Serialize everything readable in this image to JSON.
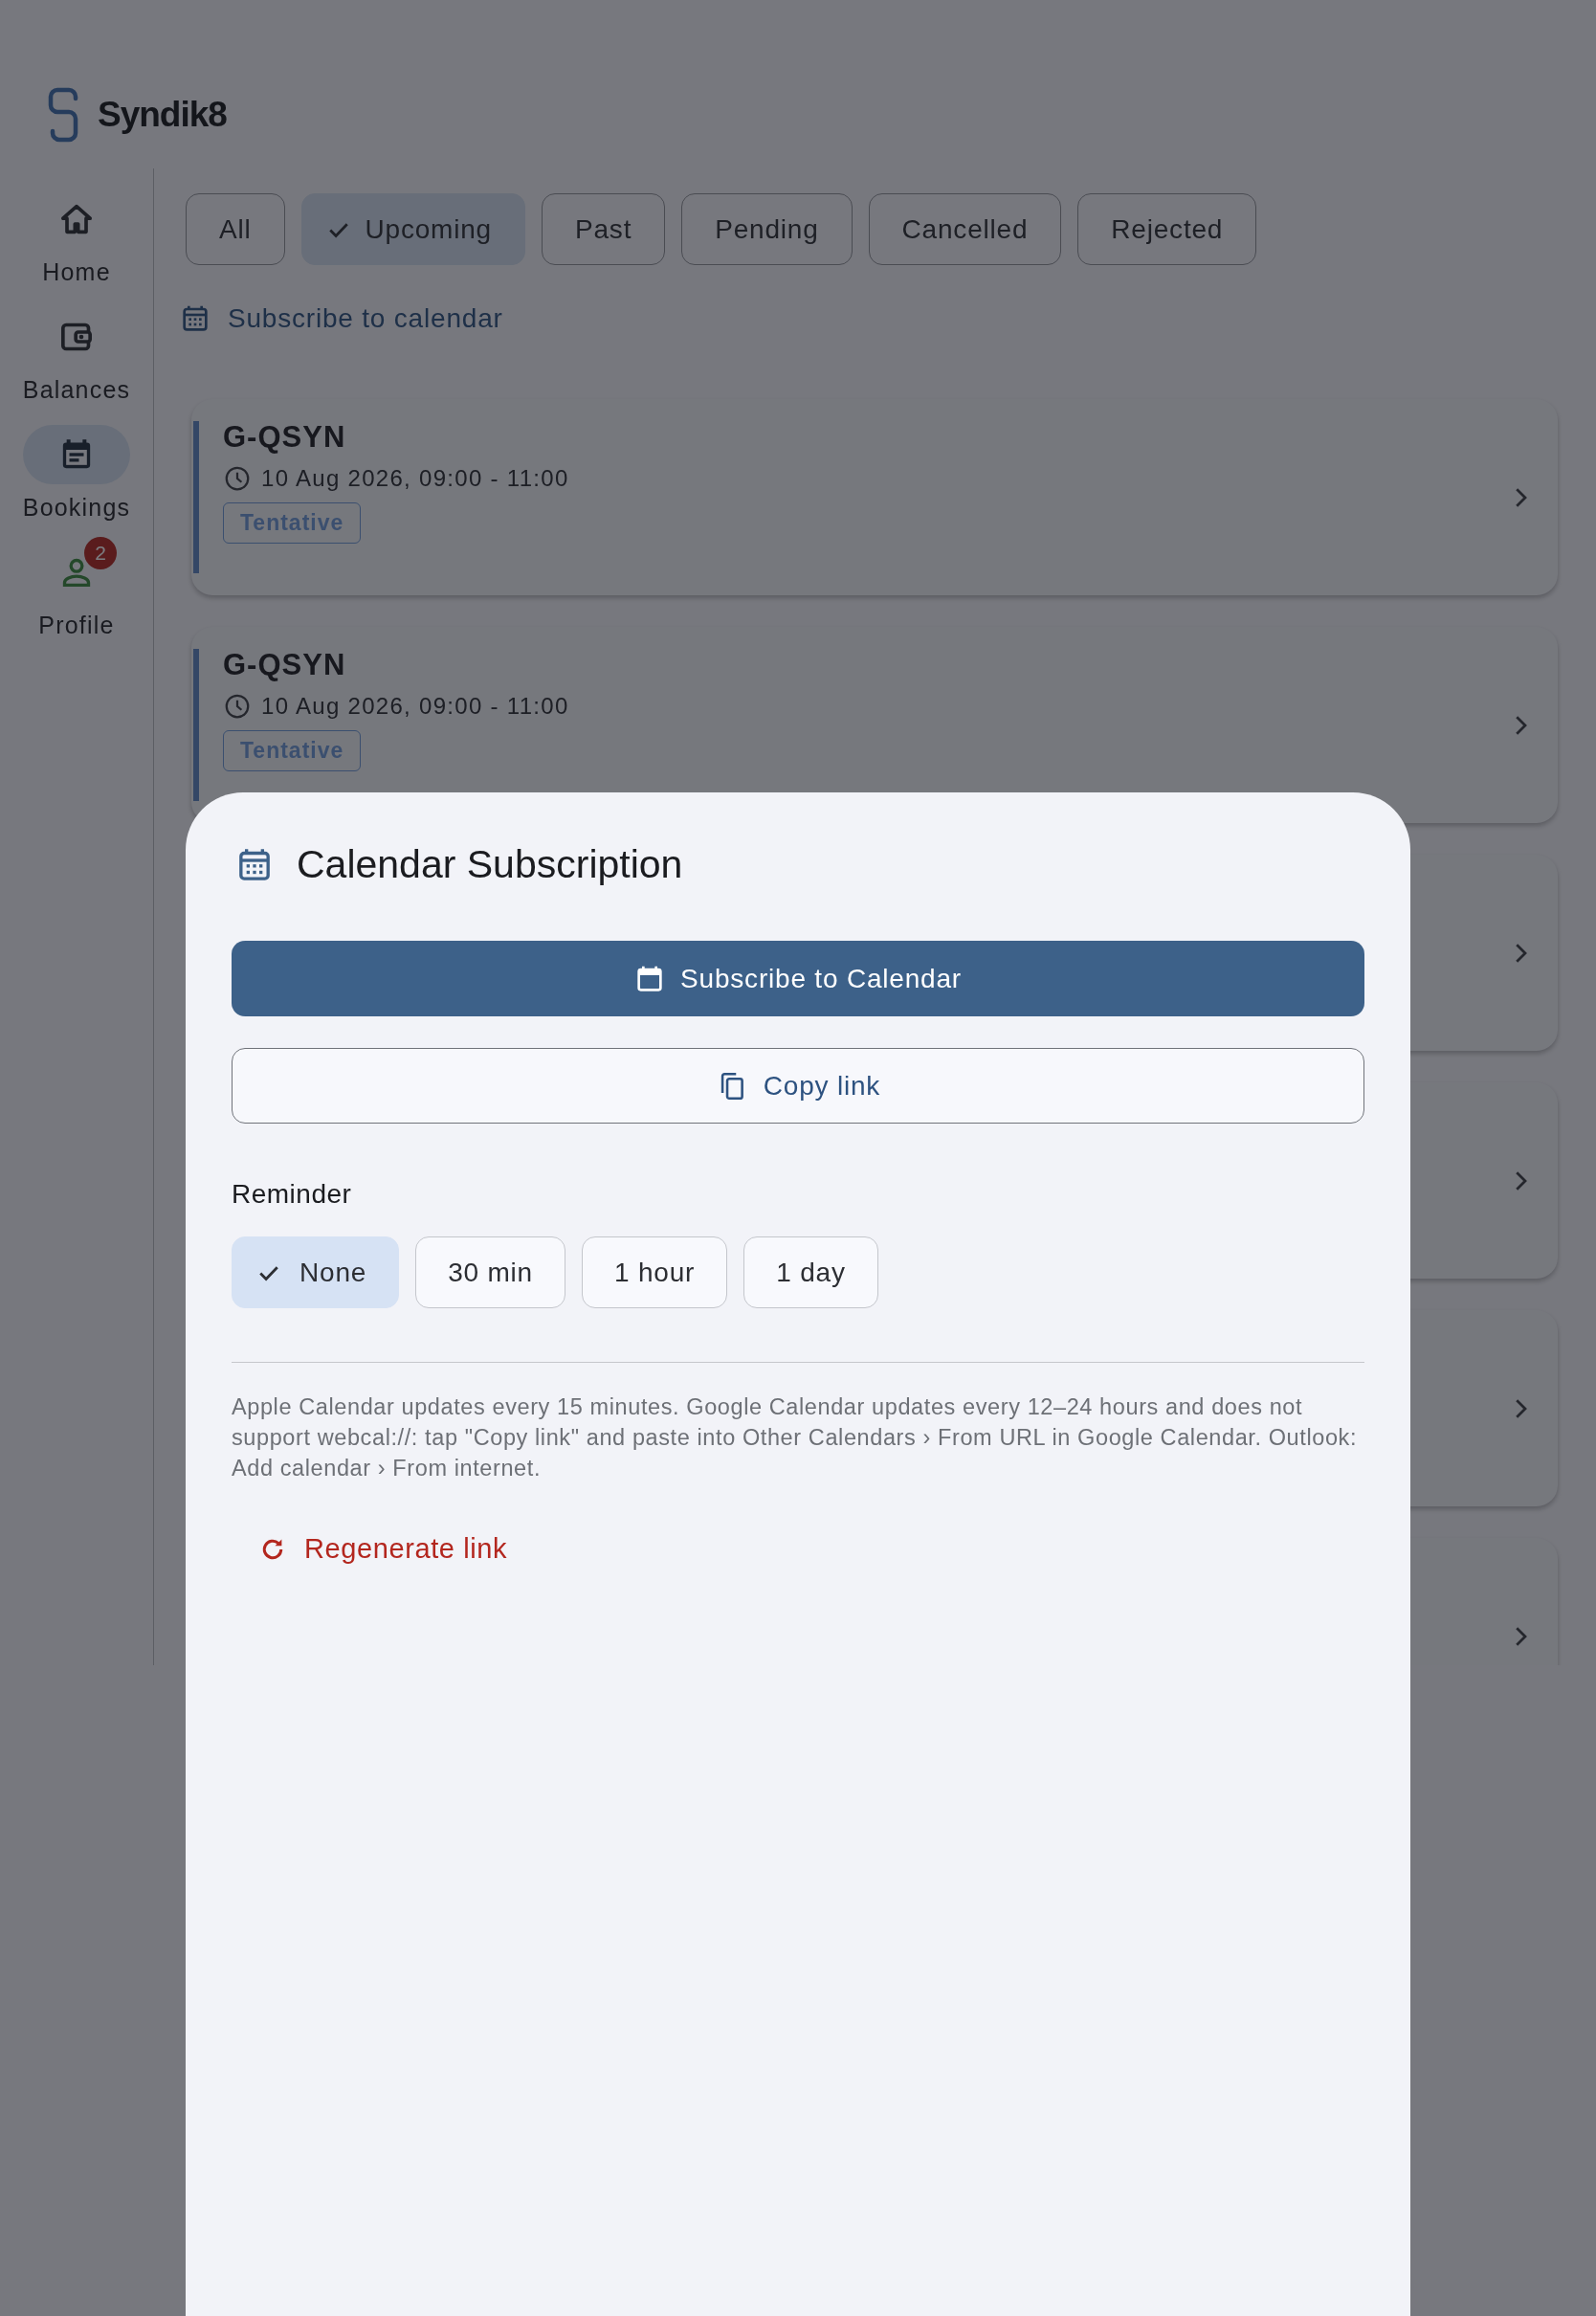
{
  "app": {
    "logo": "Syndik8"
  },
  "nav": [
    {
      "label": "Home",
      "kind": "home",
      "selected": false
    },
    {
      "label": "Balances",
      "kind": "wallet",
      "selected": false
    },
    {
      "label": "Bookings",
      "kind": "bookings",
      "selected": true
    },
    {
      "label": "Profile",
      "kind": "profile",
      "selected": false,
      "badge": "2"
    }
  ],
  "filters": [
    {
      "label": "All",
      "selected": false
    },
    {
      "label": "Upcoming",
      "selected": true
    },
    {
      "label": "Past",
      "selected": false
    },
    {
      "label": "Pending",
      "selected": false
    },
    {
      "label": "Cancelled",
      "selected": false
    },
    {
      "label": "Rejected",
      "selected": false
    }
  ],
  "subscribe_link": "Subscribe to calendar",
  "bookings": [
    {
      "kind": "full",
      "title": "G-QSYN",
      "time": "10 Aug 2026, 09:00 - 11:00",
      "status": "Tentative"
    },
    {
      "kind": "full",
      "title": "G-QSYN",
      "time": "10 Aug 2026, 09:00 - 11:00",
      "status": "Tentative"
    },
    {
      "kind": "covered"
    },
    {
      "kind": "covered"
    },
    {
      "kind": "covered"
    },
    {
      "kind": "covered"
    }
  ],
  "sheet": {
    "title": "Calendar Subscription",
    "primary_button": "Subscribe to Calendar",
    "secondary_button": "Copy link",
    "reminder": {
      "label": "Reminder",
      "options": [
        {
          "label": "None",
          "selected": true
        },
        {
          "label": "30 min",
          "selected": false
        },
        {
          "label": "1 hour",
          "selected": false
        },
        {
          "label": "1 day",
          "selected": false
        }
      ]
    },
    "note": "Apple Calendar updates every 15 minutes. Google Calendar updates every 12–24 hours and does not support webcal://: tap \"Copy link\" and paste into Other Calendars › From URL in Google Calendar. Outlook: Add calendar › From internet.",
    "regenerate_link": "Regenerate link"
  }
}
